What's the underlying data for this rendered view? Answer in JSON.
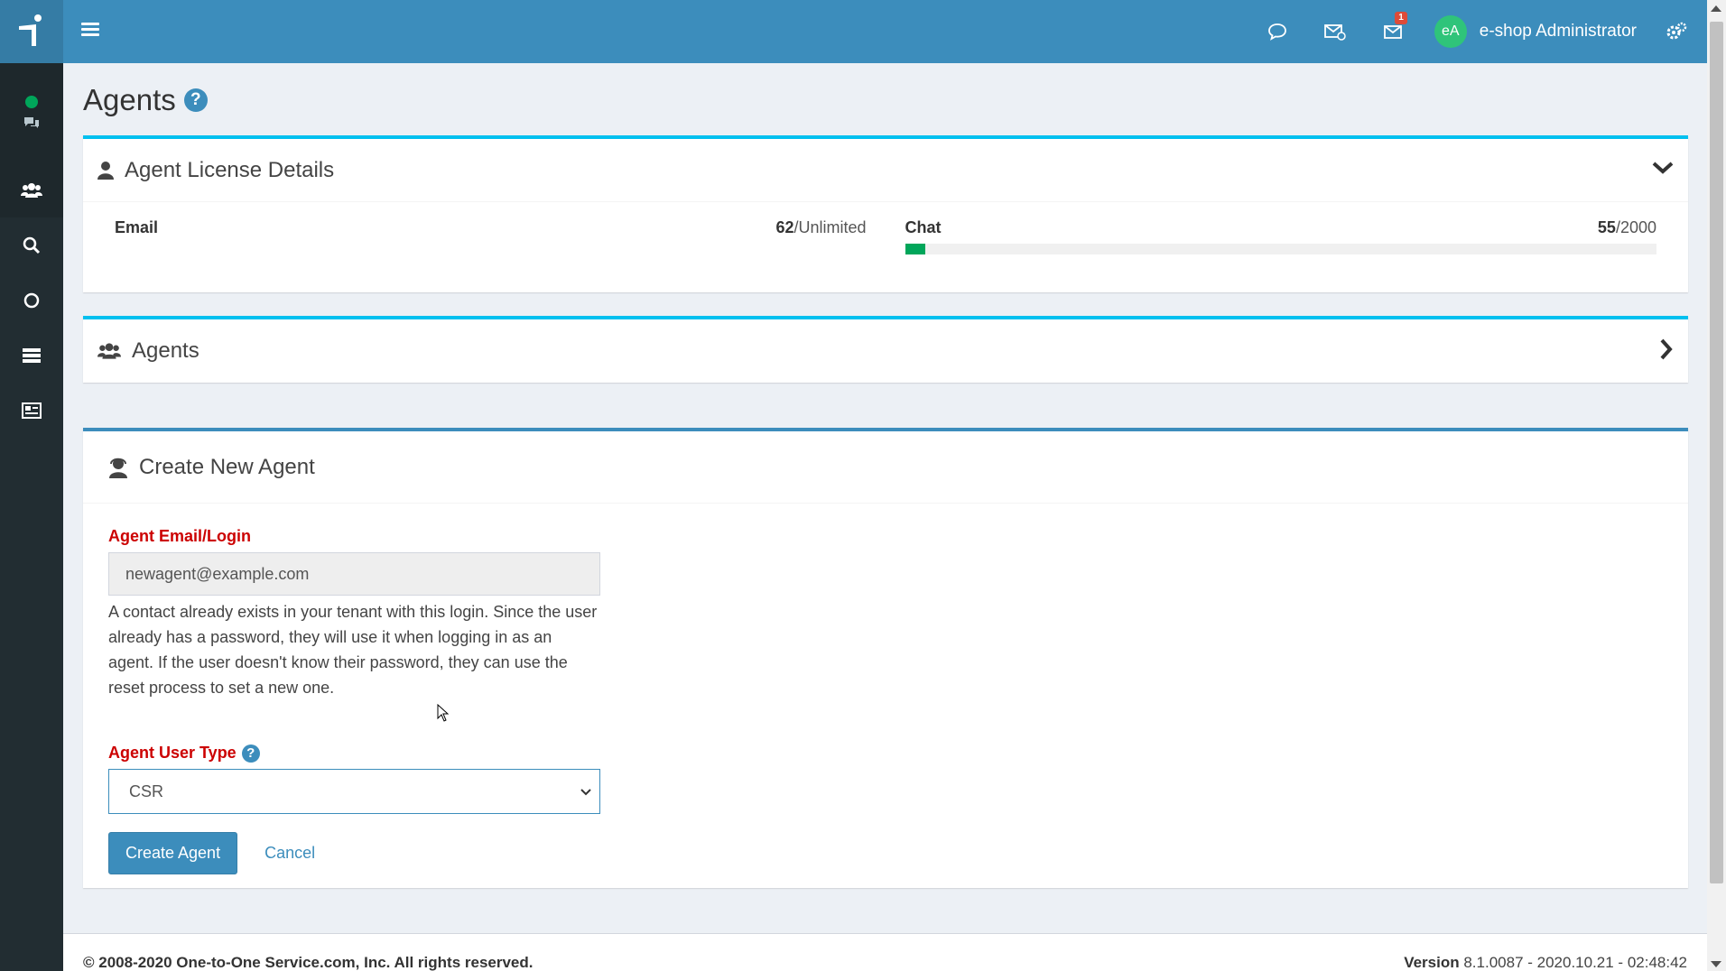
{
  "header": {
    "user_initials": "eA",
    "user_name": "e-shop Administrator",
    "mail_badge": "1"
  },
  "page": {
    "title": "Agents"
  },
  "license": {
    "title": "Agent License Details",
    "email_label": "Email",
    "email_used": "62",
    "email_limit": "/Unlimited",
    "chat_label": "Chat",
    "chat_used": "55",
    "chat_limit": "/2000",
    "chat_progress_fraction": 0.0275,
    "progress_color": "#00a65a"
  },
  "agents_panel": {
    "title": "Agents"
  },
  "create": {
    "title": "Create New Agent",
    "email_label": "Agent Email/Login",
    "email_value": "newagent@example.com",
    "help_text": "A contact already exists in your tenant with this login. Since the user already has a password, they will use it when logging in as an agent. If the user doesn't know their password, they can use the reset process to set a new one.",
    "user_type_label": "Agent User Type",
    "user_type_value": "CSR",
    "create_button": "Create Agent",
    "cancel_link": "Cancel"
  },
  "footer": {
    "copyright": "© 2008-2020 One-to-One Service.com, Inc. All rights reserved.",
    "version_label": "Version",
    "version_value": "8.1.0087 - 2020.10.21 - 02:48:42"
  },
  "colors": {
    "topbar": "#3c8dbc",
    "sidebar": "#222d32",
    "required_label": "#cc0000",
    "panel_border_cyan": "#00c0ef"
  }
}
